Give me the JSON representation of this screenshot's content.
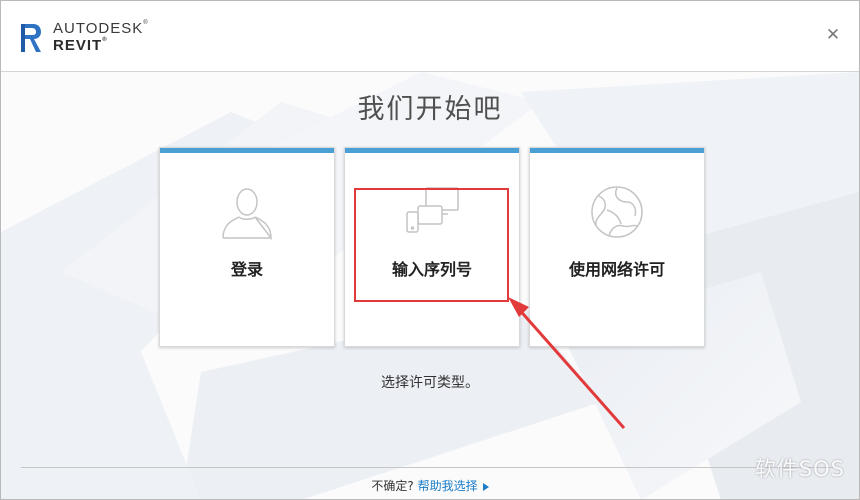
{
  "header": {
    "brand_top": "AUTODESK",
    "brand_bottom": "REVIT",
    "close_icon": "close-icon",
    "logo_icon": "revit-logo-icon"
  },
  "main": {
    "title": "我们开始吧",
    "cards": [
      {
        "label": "登录",
        "icon": "user-icon"
      },
      {
        "label": "输入序列号",
        "icon": "devices-icon"
      },
      {
        "label": "使用网络许可",
        "icon": "network-globe-icon"
      }
    ],
    "subtitle": "选择许可类型。"
  },
  "footer": {
    "question": "不确定?",
    "help_link": "帮助我选择",
    "link_icon": "play-triangle-icon"
  },
  "watermark": "软件SOS",
  "colors": {
    "card_accent": "#4aa0d5",
    "annotation_red": "#e23a3a",
    "link_blue": "#1a7cc7"
  }
}
